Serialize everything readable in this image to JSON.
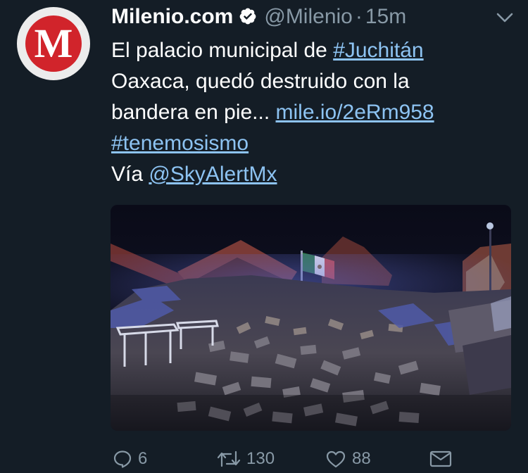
{
  "tweet": {
    "author_name": "Milenio.com",
    "handle": "@Milenio",
    "separator": "·",
    "time": "15m",
    "avatar_letter": "M",
    "avatar_reg": "®",
    "text_lines": [
      [
        {
          "t": "El palacio municipal de "
        },
        {
          "t": "#Juchitán",
          "link": true
        }
      ],
      [
        {
          "t": "Oaxaca, quedó destruido con la"
        }
      ],
      [
        {
          "t": "bandera en pie... "
        },
        {
          "t": "mile.io/2eRm958",
          "link": true
        }
      ],
      [
        {
          "t": "#tenemosismo",
          "link": true
        }
      ],
      [
        {
          "t": "Vía "
        },
        {
          "t": "@SkyAlertMx",
          "link": true
        }
      ]
    ],
    "media_description": "rubble",
    "actions": {
      "replies": "6",
      "retweets": "130",
      "likes": "88"
    }
  },
  "colors": {
    "background": "#141d26",
    "text": "#ffffff",
    "secondary": "#8899a6",
    "link": "#8dc3f2",
    "brand_red": "#d1242b"
  },
  "icons": {
    "verified": "verified-badge-icon",
    "menu": "chevron-down-icon",
    "reply": "reply-bubble-icon",
    "retweet": "retweet-icon",
    "like": "heart-icon",
    "share": "envelope-icon"
  }
}
